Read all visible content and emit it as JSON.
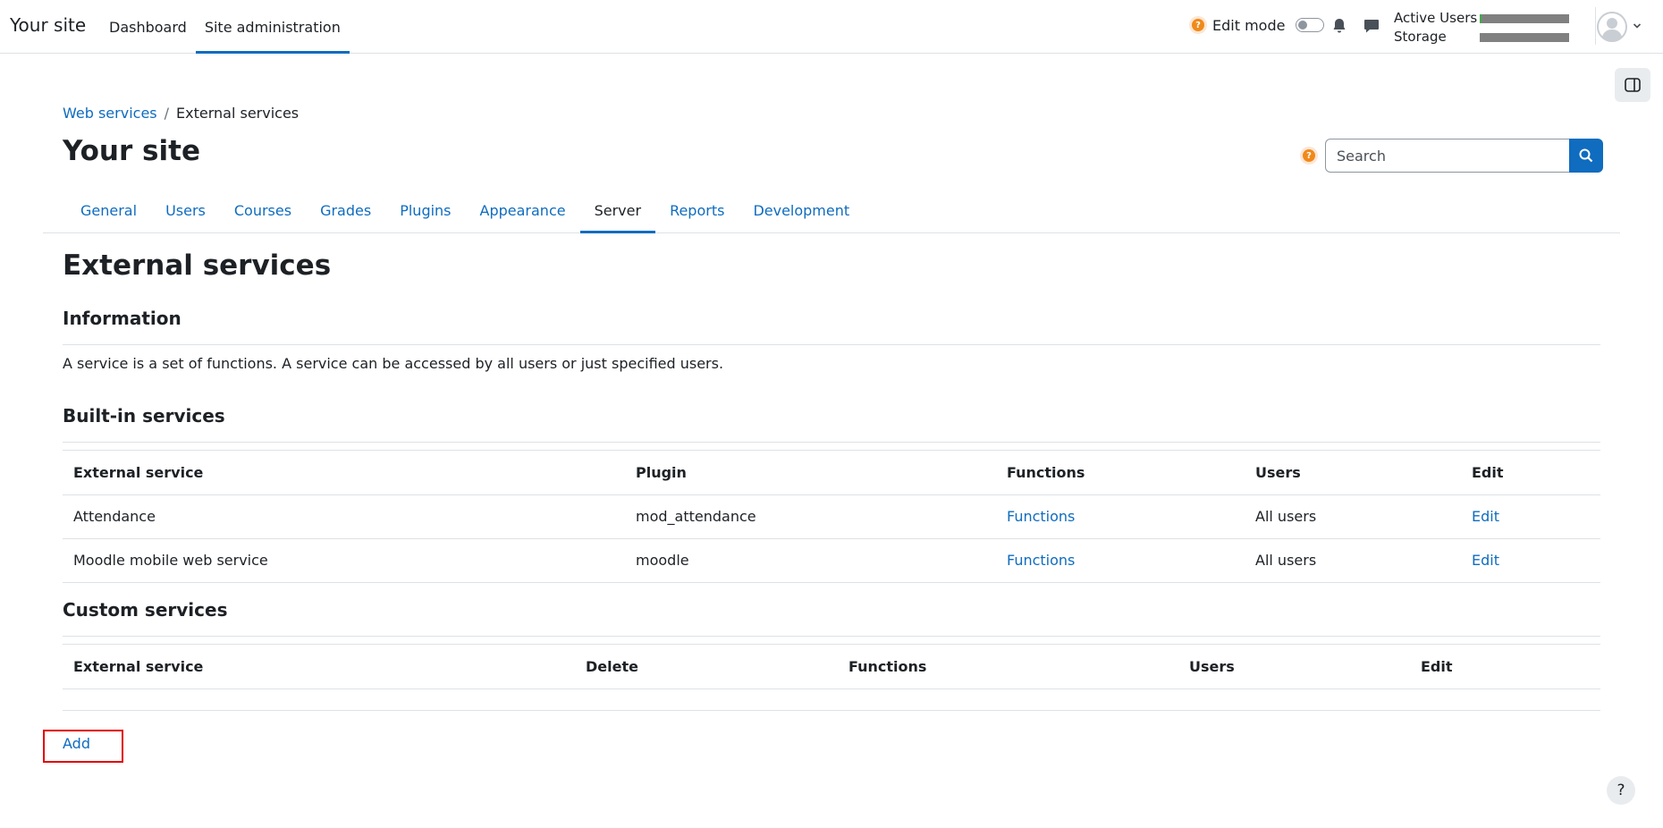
{
  "navbar": {
    "brand": "Your site",
    "items": [
      {
        "label": "Dashboard",
        "active": false
      },
      {
        "label": "Site administration",
        "active": true
      }
    ],
    "edit_mode_label": "Edit mode",
    "quota": {
      "active_users_label": "Active Users",
      "active_users_fraction": 0.02,
      "storage_label": "Storage",
      "storage_fraction": 0.0
    },
    "colors": {
      "accent": "#0f6cbf",
      "help": "#f0891a",
      "quota_fill": "#3fae49"
    }
  },
  "breadcrumb": {
    "items": [
      "Web services",
      "External services"
    ],
    "separator": "/"
  },
  "header": {
    "title": "Your site",
    "search_placeholder": "Search",
    "help_glyph": "?"
  },
  "secondary_nav": {
    "items": [
      {
        "label": "General",
        "active": false
      },
      {
        "label": "Users",
        "active": false
      },
      {
        "label": "Courses",
        "active": false
      },
      {
        "label": "Grades",
        "active": false
      },
      {
        "label": "Plugins",
        "active": false
      },
      {
        "label": "Appearance",
        "active": false
      },
      {
        "label": "Server",
        "active": true
      },
      {
        "label": "Reports",
        "active": false
      },
      {
        "label": "Development",
        "active": false
      }
    ]
  },
  "main": {
    "title": "External services",
    "information": {
      "heading": "Information",
      "text": "A service is a set of functions. A service can be accessed by all users or just specified users."
    },
    "builtin": {
      "heading": "Built-in services",
      "columns": [
        "External service",
        "Plugin",
        "Functions",
        "Users",
        "Edit"
      ],
      "rows": [
        {
          "service": "Attendance",
          "plugin": "mod_attendance",
          "functions": "Functions",
          "users": "All users",
          "edit": "Edit"
        },
        {
          "service": "Moodle mobile web service",
          "plugin": "moodle",
          "functions": "Functions",
          "users": "All users",
          "edit": "Edit"
        }
      ]
    },
    "custom": {
      "heading": "Custom services",
      "columns": [
        "External service",
        "Delete",
        "Functions",
        "Users",
        "Edit"
      ],
      "rows": []
    },
    "add_label": "Add"
  },
  "footer": {
    "help_glyph": "?"
  }
}
